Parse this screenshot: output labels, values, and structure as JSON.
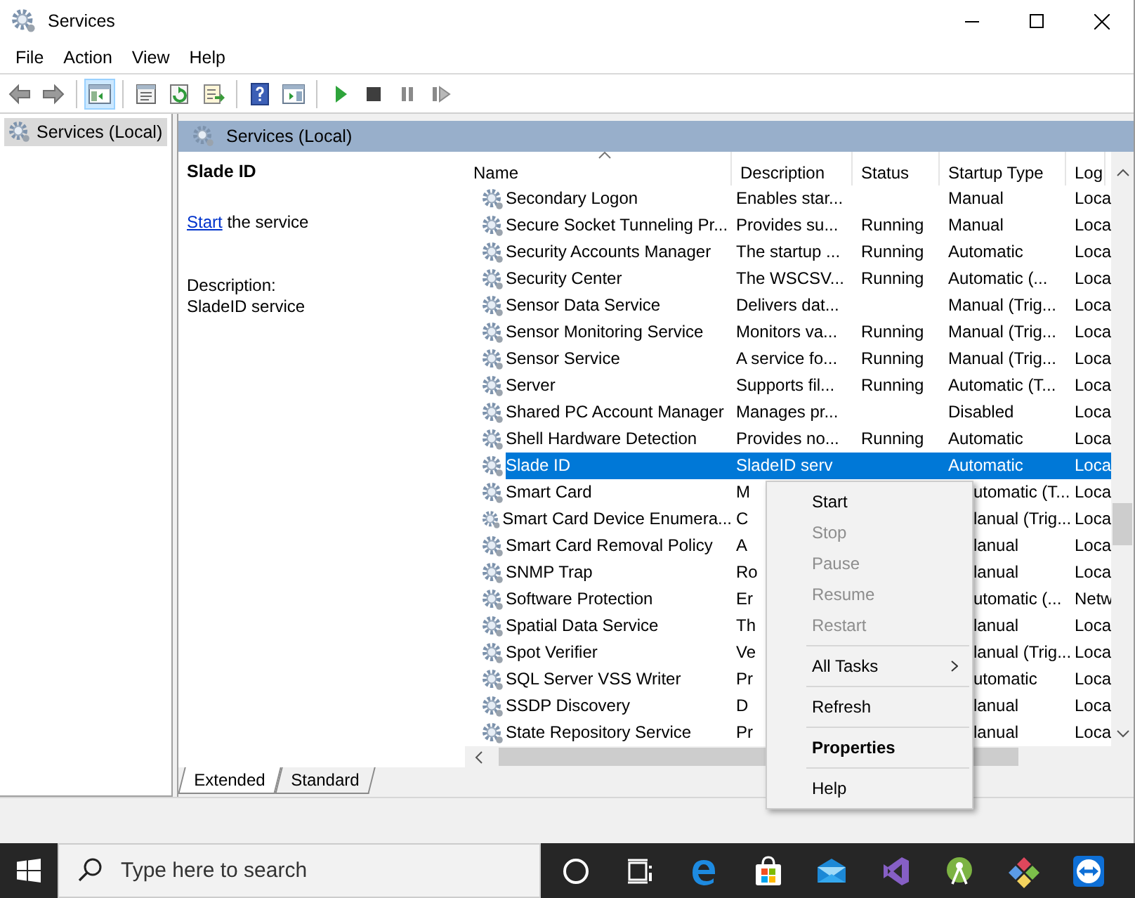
{
  "window": {
    "title": "Services"
  },
  "menu_bar": [
    "File",
    "Action",
    "View",
    "Help"
  ],
  "toolbar": [
    {
      "kind": "back",
      "pressed": false
    },
    {
      "kind": "forward",
      "pressed": false
    },
    {
      "kind": "separator"
    },
    {
      "kind": "console-tree",
      "pressed": true
    },
    {
      "kind": "separator"
    },
    {
      "kind": "properties",
      "pressed": false
    },
    {
      "kind": "refresh",
      "pressed": false
    },
    {
      "kind": "export",
      "pressed": false
    },
    {
      "kind": "separator"
    },
    {
      "kind": "help",
      "pressed": false
    },
    {
      "kind": "action-pane",
      "pressed": false
    },
    {
      "kind": "separator"
    },
    {
      "kind": "start",
      "pressed": false
    },
    {
      "kind": "stop",
      "pressed": false
    },
    {
      "kind": "pause",
      "pressed": false
    },
    {
      "kind": "resume",
      "pressed": false
    }
  ],
  "tree": {
    "items": [
      {
        "label": "Services (Local)",
        "selected": true
      }
    ]
  },
  "panel": {
    "title": "Services (Local)"
  },
  "details": {
    "title": "Slade ID",
    "action_link": "Start",
    "action_text": "the service",
    "description_label": "Description:",
    "description": "SladeID service"
  },
  "table": {
    "columns": [
      {
        "label": "Name",
        "sorted": true
      },
      {
        "label": "Description",
        "sorted": false
      },
      {
        "label": "Status",
        "sorted": false
      },
      {
        "label": "Startup Type",
        "sorted": false
      },
      {
        "label": "Log",
        "sorted": false
      }
    ],
    "rows": [
      {
        "name": "Secondary Logon",
        "description": "Enables star...",
        "status": "",
        "startup_type": "Manual",
        "column_5": "Loca",
        "selected": false
      },
      {
        "name": "Secure Socket Tunneling Pr...",
        "description": "Provides su...",
        "status": "Running",
        "startup_type": "Manual",
        "column_5": "Loca",
        "selected": false
      },
      {
        "name": "Security Accounts Manager",
        "description": "The startup ...",
        "status": "Running",
        "startup_type": "Automatic",
        "column_5": "Loca",
        "selected": false
      },
      {
        "name": "Security Center",
        "description": "The WSCSV...",
        "status": "Running",
        "startup_type": "Automatic (...",
        "column_5": "Loca",
        "selected": false
      },
      {
        "name": "Sensor Data Service",
        "description": "Delivers dat...",
        "status": "",
        "startup_type": "Manual (Trig...",
        "column_5": "Loca",
        "selected": false
      },
      {
        "name": "Sensor Monitoring Service",
        "description": "Monitors va...",
        "status": "Running",
        "startup_type": "Manual (Trig...",
        "column_5": "Loca",
        "selected": false
      },
      {
        "name": "Sensor Service",
        "description": "A service fo...",
        "status": "Running",
        "startup_type": "Manual (Trig...",
        "column_5": "Loca",
        "selected": false
      },
      {
        "name": "Server",
        "description": "Supports fil...",
        "status": "Running",
        "startup_type": "Automatic (T...",
        "column_5": "Loca",
        "selected": false
      },
      {
        "name": "Shared PC Account Manager",
        "description": "Manages pr...",
        "status": "",
        "startup_type": "Disabled",
        "column_5": "Loca",
        "selected": false
      },
      {
        "name": "Shell Hardware Detection",
        "description": "Provides no...",
        "status": "Running",
        "startup_type": "Automatic",
        "column_5": "Loca",
        "selected": false
      },
      {
        "name": "Slade ID",
        "description": "SladeID serv",
        "status": "",
        "startup_type": "Automatic",
        "column_5": "Loca",
        "selected": true
      },
      {
        "name": "Smart Card",
        "description": "M",
        "status": "",
        "startup_type": "utomatic (T...",
        "column_5": "Loca",
        "selected": false
      },
      {
        "name": "Smart Card Device Enumera...",
        "description": "C",
        "status": "",
        "startup_type": "lanual (Trig...",
        "column_5": "Loca",
        "selected": false
      },
      {
        "name": "Smart Card Removal Policy",
        "description": "A",
        "status": "",
        "startup_type": "lanual",
        "column_5": "Loca",
        "selected": false
      },
      {
        "name": "SNMP Trap",
        "description": "Ro",
        "status": "",
        "startup_type": "lanual",
        "column_5": "Loca",
        "selected": false
      },
      {
        "name": "Software Protection",
        "description": "Er",
        "status": "",
        "startup_type": "utomatic (...",
        "column_5": "Netw",
        "selected": false
      },
      {
        "name": "Spatial Data Service",
        "description": "Th",
        "status": "",
        "startup_type": "lanual",
        "column_5": "Loca",
        "selected": false
      },
      {
        "name": "Spot Verifier",
        "description": "Ve",
        "status": "",
        "startup_type": "lanual (Trig...",
        "column_5": "Loca",
        "selected": false
      },
      {
        "name": "SQL Server VSS Writer",
        "description": "Pr",
        "status": "",
        "startup_type": "utomatic",
        "column_5": "Loca",
        "selected": false
      },
      {
        "name": "SSDP Discovery",
        "description": "D",
        "status": "",
        "startup_type": "lanual",
        "column_5": "Loca",
        "selected": false
      },
      {
        "name": "State Repository Service",
        "description": "Pr",
        "status": "",
        "startup_type": "lanual",
        "column_5": "Loca",
        "selected": false
      }
    ]
  },
  "context_menu": {
    "items": [
      {
        "kind": "item",
        "label": "Start",
        "disabled": false,
        "default": false
      },
      {
        "kind": "item",
        "label": "Stop",
        "disabled": true,
        "default": false
      },
      {
        "kind": "item",
        "label": "Pause",
        "disabled": true,
        "default": false
      },
      {
        "kind": "item",
        "label": "Resume",
        "disabled": true,
        "default": false
      },
      {
        "kind": "item",
        "label": "Restart",
        "disabled": true,
        "default": false
      },
      {
        "kind": "separator"
      },
      {
        "kind": "submenu",
        "label": "All Tasks",
        "disabled": false,
        "default": false
      },
      {
        "kind": "separator"
      },
      {
        "kind": "item",
        "label": "Refresh",
        "disabled": false,
        "default": false
      },
      {
        "kind": "separator"
      },
      {
        "kind": "item",
        "label": "Properties",
        "disabled": false,
        "default": true
      },
      {
        "kind": "separator"
      },
      {
        "kind": "item",
        "label": "Help",
        "disabled": false,
        "default": false
      }
    ]
  },
  "view_tabs": [
    {
      "label": "Extended",
      "selected": true
    },
    {
      "label": "Standard",
      "selected": false
    }
  ],
  "taskbar": {
    "search_placeholder": "Type here to search",
    "apps": [
      {
        "kind": "cortana"
      },
      {
        "kind": "task-view"
      },
      {
        "kind": "edge"
      },
      {
        "kind": "store"
      },
      {
        "kind": "mail"
      },
      {
        "kind": "visual-studio"
      },
      {
        "kind": "android-studio"
      },
      {
        "kind": "git"
      },
      {
        "kind": "teamviewer"
      }
    ]
  }
}
